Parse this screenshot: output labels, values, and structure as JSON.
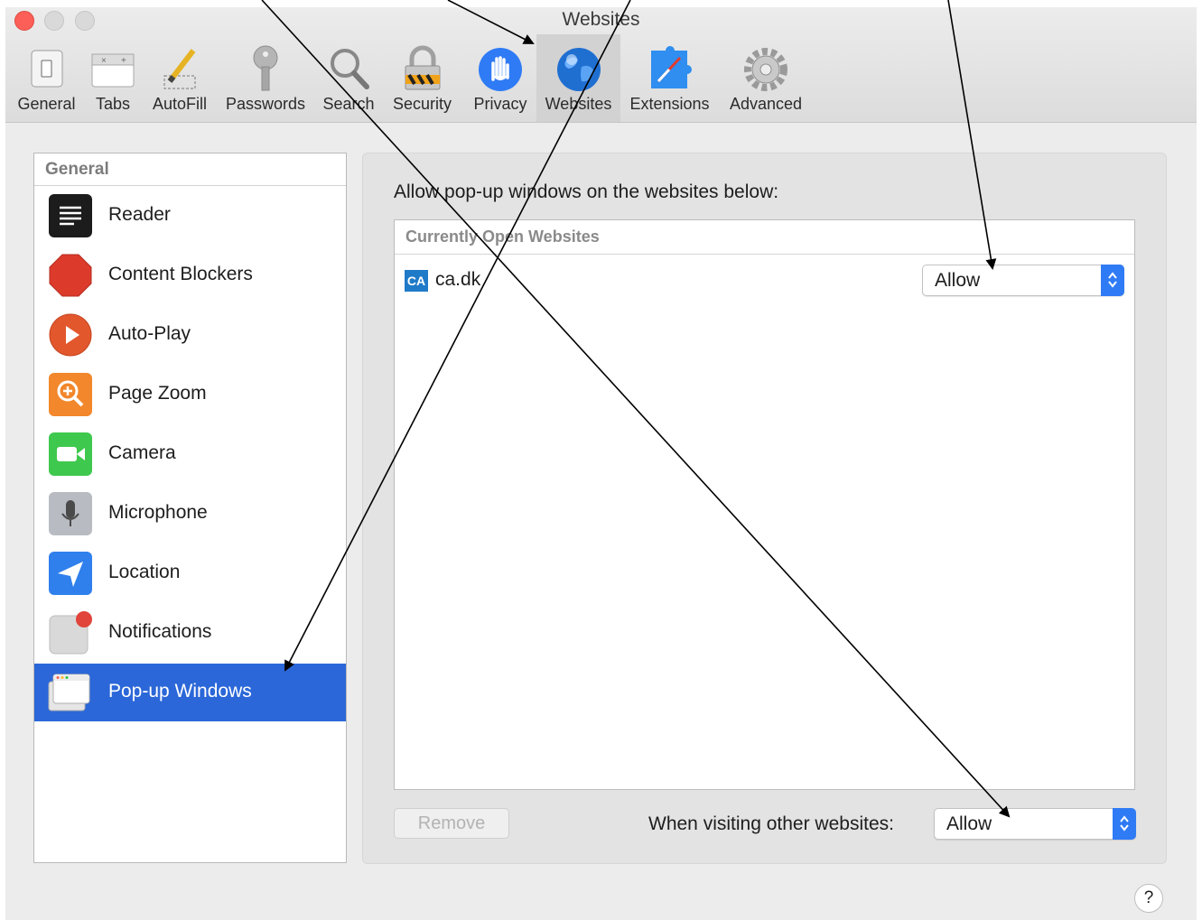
{
  "window": {
    "title": "Websites"
  },
  "toolbar": {
    "items": [
      {
        "label": "General",
        "icon": "general-switch-icon"
      },
      {
        "label": "Tabs",
        "icon": "tabs-icon"
      },
      {
        "label": "AutoFill",
        "icon": "pencil-icon"
      },
      {
        "label": "Passwords",
        "icon": "key-icon"
      },
      {
        "label": "Search",
        "icon": "magnifier-icon"
      },
      {
        "label": "Security",
        "icon": "padlock-icon"
      },
      {
        "label": "Privacy",
        "icon": "hand-icon"
      },
      {
        "label": "Websites",
        "icon": "globe-icon",
        "selected": true
      },
      {
        "label": "Extensions",
        "icon": "puzzle-icon"
      },
      {
        "label": "Advanced",
        "icon": "gear-icon"
      }
    ]
  },
  "sidebar": {
    "header": "General",
    "items": [
      {
        "label": "Reader",
        "icon": "reader-icon"
      },
      {
        "label": "Content Blockers",
        "icon": "stop-sign-icon"
      },
      {
        "label": "Auto-Play",
        "icon": "play-icon"
      },
      {
        "label": "Page Zoom",
        "icon": "zoom-icon"
      },
      {
        "label": "Camera",
        "icon": "camera-icon"
      },
      {
        "label": "Microphone",
        "icon": "microphone-icon"
      },
      {
        "label": "Location",
        "icon": "location-arrow-icon"
      },
      {
        "label": "Notifications",
        "icon": "notification-badge-icon"
      },
      {
        "label": "Pop-up Windows",
        "icon": "popup-window-icon",
        "selected": true
      }
    ]
  },
  "main": {
    "prompt": "Allow pop-up windows on the websites below:",
    "list_header": "Currently Open Websites",
    "sites": [
      {
        "favicon": "CA",
        "domain": "ca.dk",
        "setting": "Allow"
      }
    ],
    "remove_label": "Remove",
    "other_label": "When visiting other websites:",
    "other_setting": "Allow"
  },
  "help": "?",
  "colors": {
    "selection": "#2b67d8",
    "popup_stepper": "#2f7bf5",
    "close": "#fc5f57",
    "annotation_arrows": "#000000"
  }
}
